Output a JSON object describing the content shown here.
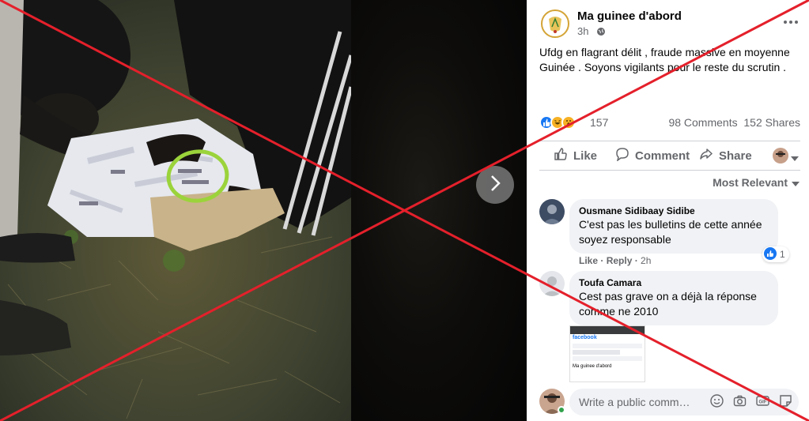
{
  "post": {
    "page_name": "Ma guinee d'abord",
    "time": "3h",
    "text": "Ufdg en flagrant délit , fraude massive en moyenne Guinée . Soyons vigilants pour le reste du scrutin .",
    "reaction_count": "157",
    "comments_count": "98 Comments",
    "shares_count": "152 Shares"
  },
  "actions": {
    "like": "Like",
    "comment": "Comment",
    "share": "Share"
  },
  "comments": {
    "sort_label": "Most Relevant",
    "items": [
      {
        "author": "Ousmane Sidibaay Sidibe",
        "text": "C'est pas les bulletins de cette année soyez responsable",
        "like": "Like",
        "reply": "Reply",
        "time": "2h",
        "reaction_count": "1"
      },
      {
        "author": "Toufa Camara",
        "text": "Cest pas grave on a déjà la réponse comme ne 2010"
      }
    ],
    "attachment": {
      "app_label": "facebook",
      "page_label": "Ma guinee d'abord"
    }
  },
  "composer": {
    "placeholder": "Write a public comm…"
  },
  "icons": {
    "next": "chevron-right-icon",
    "globe": "globe-icon",
    "more": "more-dots-icon",
    "like": "thumbs-up-icon",
    "comment": "speech-bubble-icon",
    "share": "share-arrow-icon",
    "sort": "caret-down-icon",
    "emoji": "emoji-icon",
    "camera": "camera-icon",
    "gif": "gif-icon",
    "sticker": "sticker-icon"
  },
  "colors": {
    "like_blue": "#1877f2",
    "haha_yellow": "#f7b125",
    "text_secondary": "#65676b",
    "cross_red": "#e4202b",
    "online_green": "#31a24c"
  }
}
